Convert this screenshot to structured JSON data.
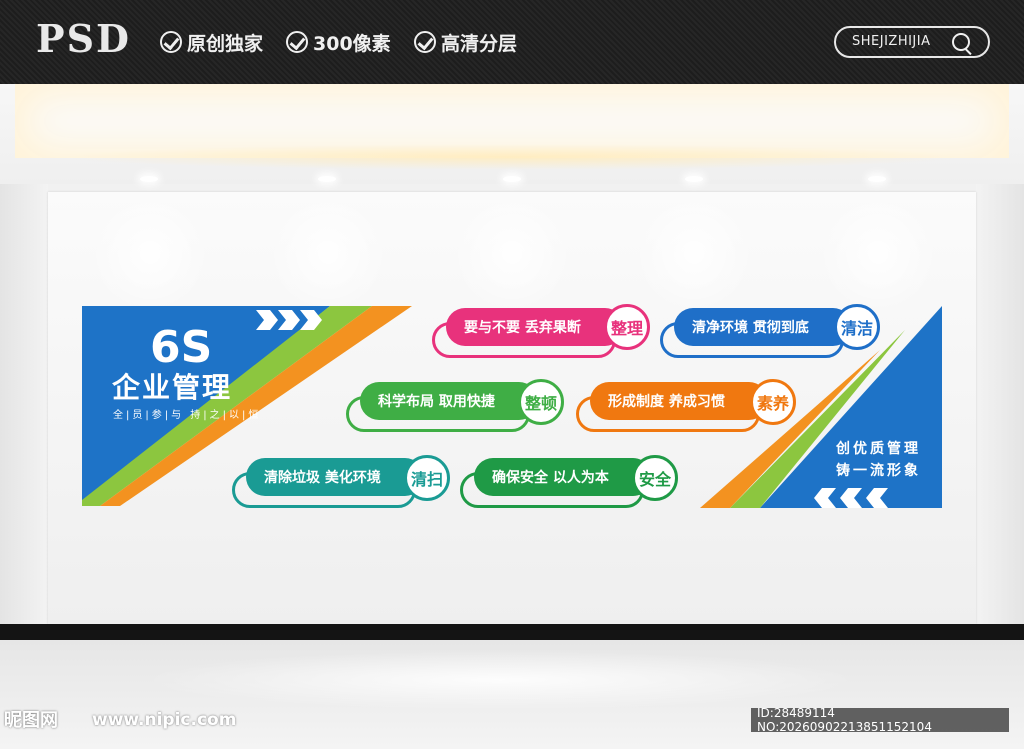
{
  "banner": {
    "brand": "PSD",
    "features": [
      "原创独家",
      "300像素",
      "高清分层"
    ],
    "search_label": "SHEJIZHIJIA"
  },
  "board": {
    "title_6s": "6S",
    "title_main": "企业管理",
    "subtitle": "全|员|参|与 持|之|以|恒",
    "slogan_line1": "创优质管理",
    "slogan_line2": "铸一流形象",
    "items": [
      {
        "text": "要与不要 丢弃果断",
        "badge": "整理",
        "color": "#e8327c"
      },
      {
        "text": "清净环境 贯彻到底",
        "badge": "清洁",
        "color": "#1f6fc8"
      },
      {
        "text": "科学布局 取用快捷",
        "badge": "整顿",
        "color": "#3fae45"
      },
      {
        "text": "形成制度 养成习惯",
        "badge": "素养",
        "color": "#f07810"
      },
      {
        "text": "清除垃圾 美化环境",
        "badge": "清扫",
        "color": "#1a9b94"
      },
      {
        "text": "确保安全 以人为本",
        "badge": "安全",
        "color": "#1f9a46"
      }
    ],
    "colors": {
      "blue": "#1e73c7",
      "green": "#8cc63f",
      "orange": "#f39220"
    }
  },
  "watermark": {
    "site_name": "昵图网",
    "url": "www.nipic.com",
    "id_text": "ID:28489114 NO:20260902213851152104"
  }
}
